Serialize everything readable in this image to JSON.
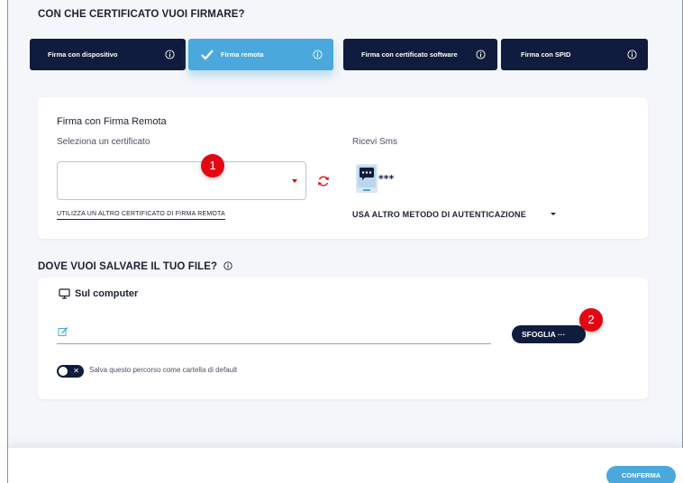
{
  "sections": {
    "certificate_title": "CON CHE CERTIFICATO VUOI FIRMARE?",
    "save_title": "DOVE VUOI SALVARE IL TUO FILE?"
  },
  "tabs": [
    {
      "label": "Firma con dispositivo",
      "active": false
    },
    {
      "label": "Firma remota",
      "active": true
    },
    {
      "label": "Firma con certificato software",
      "active": false
    },
    {
      "label": "Firma con SPID",
      "active": false
    }
  ],
  "remote_card": {
    "title": "Firma con Firma Remota",
    "select_label": "Seleziona un certificato",
    "select_value": "",
    "other_cert_link": "UTILIZZA UN ALTRO CERTIFICATO DI FIRMA REMOTA",
    "sms_label": "Ricevi Sms",
    "sms_icon": "sms-password-icon",
    "auth_method_label": "USA ALTRO METODO DI AUTENTICAZIONE"
  },
  "save_card": {
    "location_label": "Sul computer",
    "location_icon": "monitor-icon",
    "path_value": "",
    "browse_label": "SFOGLIA ···",
    "toggle_label": "Salva questo percorso come cartella di default",
    "toggle_on": false
  },
  "markers": [
    "1",
    "2"
  ],
  "footer": {
    "confirm_label": "CONFERMA"
  },
  "colors": {
    "navy": "#0f1c3d",
    "accent_blue": "#4aa8dc",
    "marker_red": "#e30613",
    "background": "#f4f6f9"
  }
}
